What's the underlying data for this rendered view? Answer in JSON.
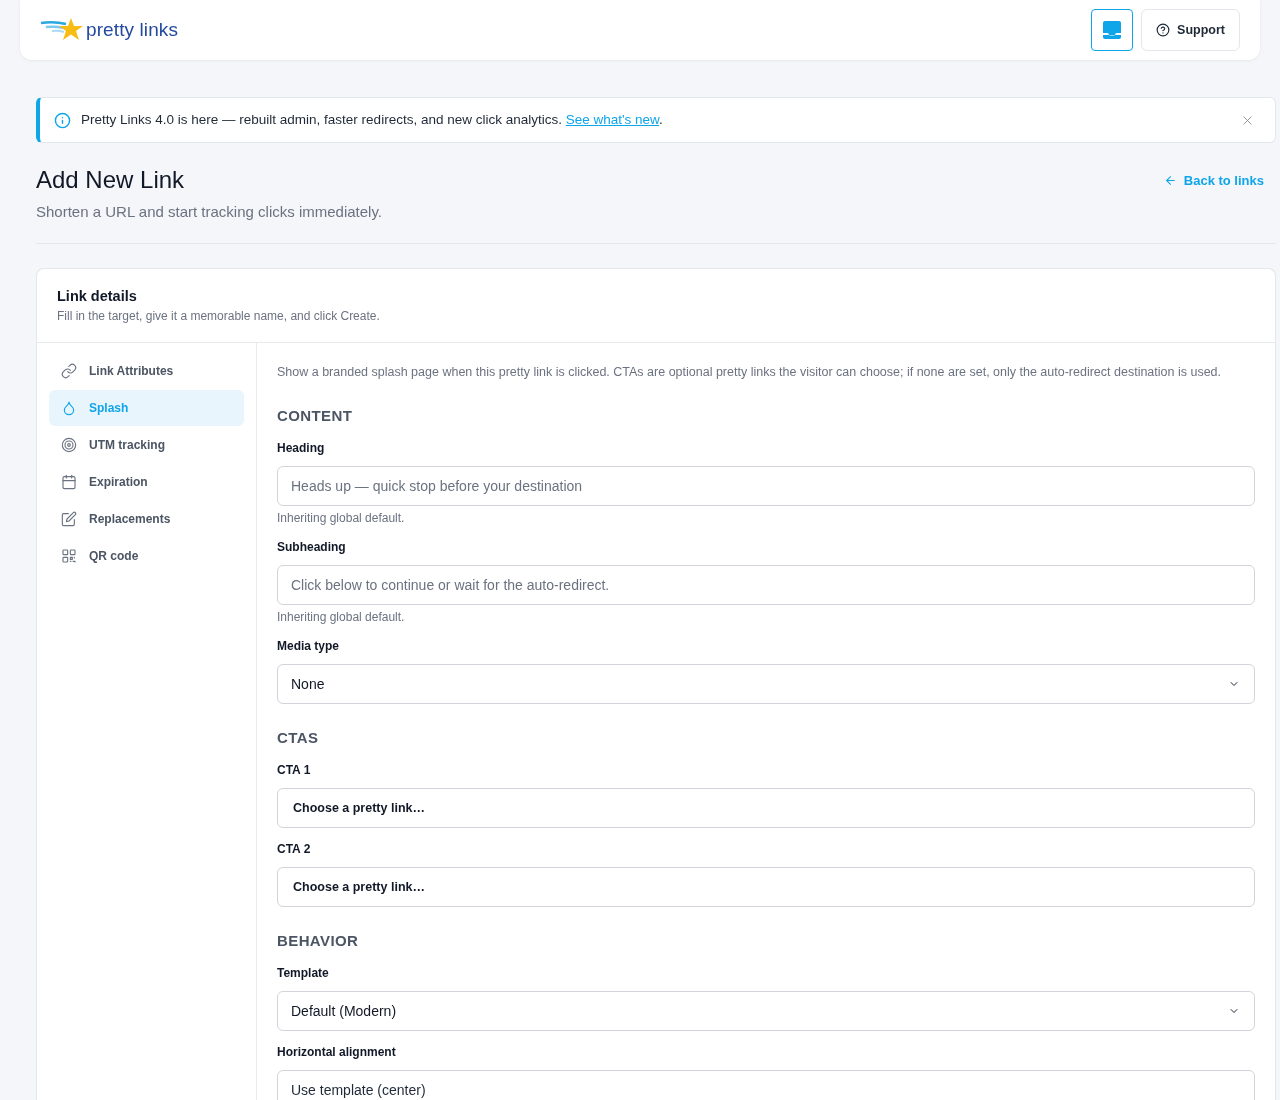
{
  "header": {
    "logo_text": "pretty links",
    "support_button": "Support"
  },
  "notice": {
    "message": "Pretty Links 4.0 is here — rebuilt admin, faster redirects, and new click analytics. ",
    "link": "See what's new",
    "after_link": "."
  },
  "page": {
    "title": "Add New Link",
    "subtitle": "Shorten a URL and start tracking clicks immediately.",
    "back_link": "Back to links"
  },
  "card": {
    "title": "Link details",
    "subtitle": "Fill in the target, give it a memorable name, and click Create."
  },
  "sidebar": {
    "items": [
      {
        "label": "Link Attributes",
        "selected": false
      },
      {
        "label": "Splash",
        "selected": true
      },
      {
        "label": "UTM tracking",
        "selected": false
      },
      {
        "label": "Expiration",
        "selected": false
      },
      {
        "label": "Replacements",
        "selected": false
      },
      {
        "label": "QR code",
        "selected": false
      }
    ]
  },
  "content": {
    "description": "Show a branded splash page when this pretty link is clicked. CTAs are optional pretty links the visitor can choose; if none are set, only the auto-redirect destination is used.",
    "sections": [
      {
        "title": "CONTENT",
        "fields": [
          {
            "label": "Heading",
            "kind": "text",
            "placeholder": "Heads up — quick stop before your destination",
            "hint": "Inheriting global default."
          },
          {
            "label": "Subheading",
            "kind": "text",
            "placeholder": "Click below to continue or wait for the auto-redirect.",
            "hint": "Inheriting global default."
          },
          {
            "label": "Media type",
            "kind": "select",
            "value": "None"
          }
        ]
      },
      {
        "title": "CTAS",
        "fields": [
          {
            "label": "CTA 1",
            "kind": "picker",
            "value": "Choose a pretty link…"
          },
          {
            "label": "CTA 2",
            "kind": "picker",
            "value": "Choose a pretty link…"
          }
        ]
      },
      {
        "title": "BEHAVIOR",
        "fields": [
          {
            "label": "Template",
            "kind": "select",
            "value": "Default (Modern)"
          },
          {
            "label": "Horizontal alignment",
            "kind": "input",
            "value": "Use template (center)"
          }
        ]
      }
    ]
  }
}
